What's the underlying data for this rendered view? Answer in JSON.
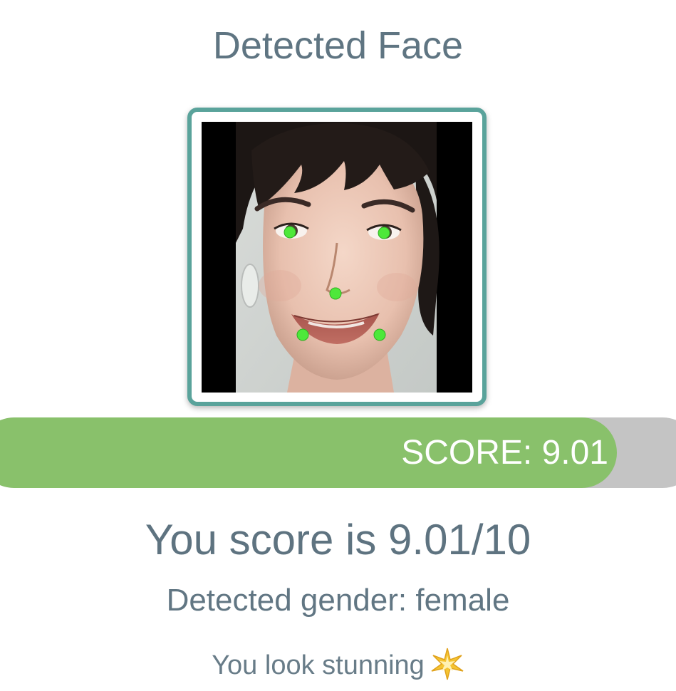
{
  "header": {
    "title": "Detected Face"
  },
  "face": {
    "icon": "face-photo",
    "landmark_color": "#4ee83a",
    "landmark_count": 5
  },
  "score_bar": {
    "label": "SCORE: 9.01",
    "fraction": 0.901,
    "fill_color": "#89c16b",
    "track_color": "#c4c4c4"
  },
  "result": {
    "score_text": "You score is 9.01/10",
    "gender_text": "Detected gender: female",
    "compliment": "You look stunning",
    "compliment_icon": "sparkles-icon"
  },
  "colors": {
    "frame": "#5aa39b",
    "text": "#5f7582"
  }
}
